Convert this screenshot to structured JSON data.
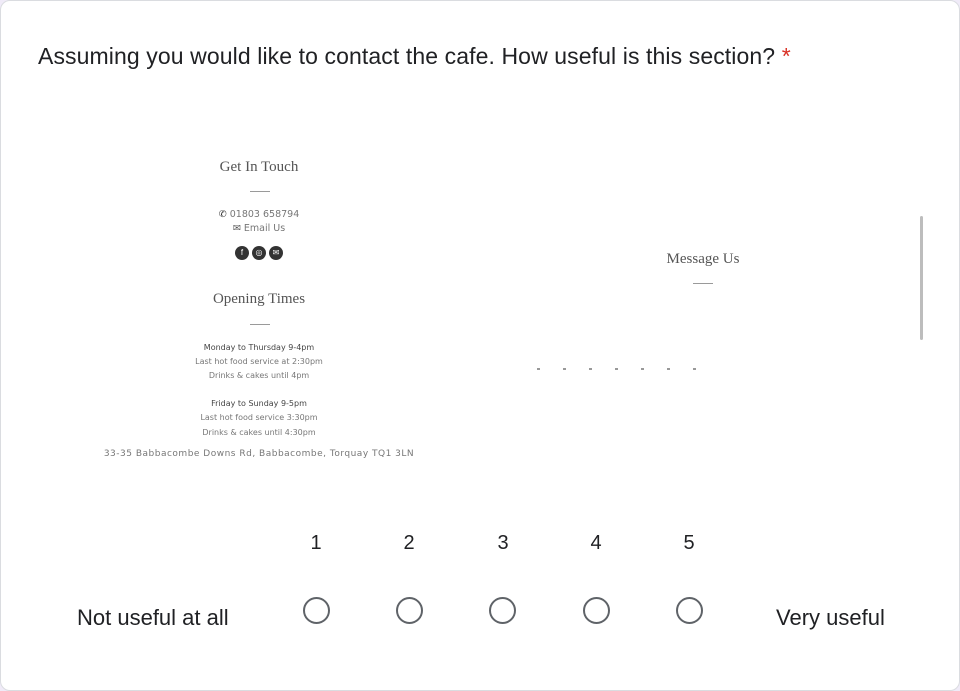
{
  "question": {
    "text": "Assuming you would like to contact the cafe. How useful is this section?",
    "required_marker": "*"
  },
  "embedded_image": {
    "get_in_touch": {
      "heading": "Get In Touch",
      "phone_icon": "phone-icon",
      "phone": "01803 658794",
      "email_icon": "envelope-icon",
      "email": "Email Us",
      "social_icons": [
        "facebook-icon",
        "instagram-icon",
        "email-icon"
      ]
    },
    "opening_times": {
      "heading": "Opening Times",
      "block1": {
        "title": "Monday to Thursday 9-4pm",
        "line1": "Last hot food service at 2:30pm",
        "line2": "Drinks & cakes until 4pm"
      },
      "block2": {
        "title": "Friday to Sunday 9-5pm",
        "line1": "Last hot food service 3:30pm",
        "line2": "Drinks & cakes until 4:30pm"
      }
    },
    "address": "33-35 Babbacombe Downs Rd, Babbacombe, Torquay TQ1 3LN",
    "message_us": {
      "heading": "Message Us"
    }
  },
  "scale": {
    "numbers": [
      "1",
      "2",
      "3",
      "4",
      "5"
    ],
    "low_label": "Not useful at all",
    "high_label": "Very useful"
  },
  "colors": {
    "required": "#d93025",
    "radio_border": "#5f6368",
    "text": "#202124"
  }
}
